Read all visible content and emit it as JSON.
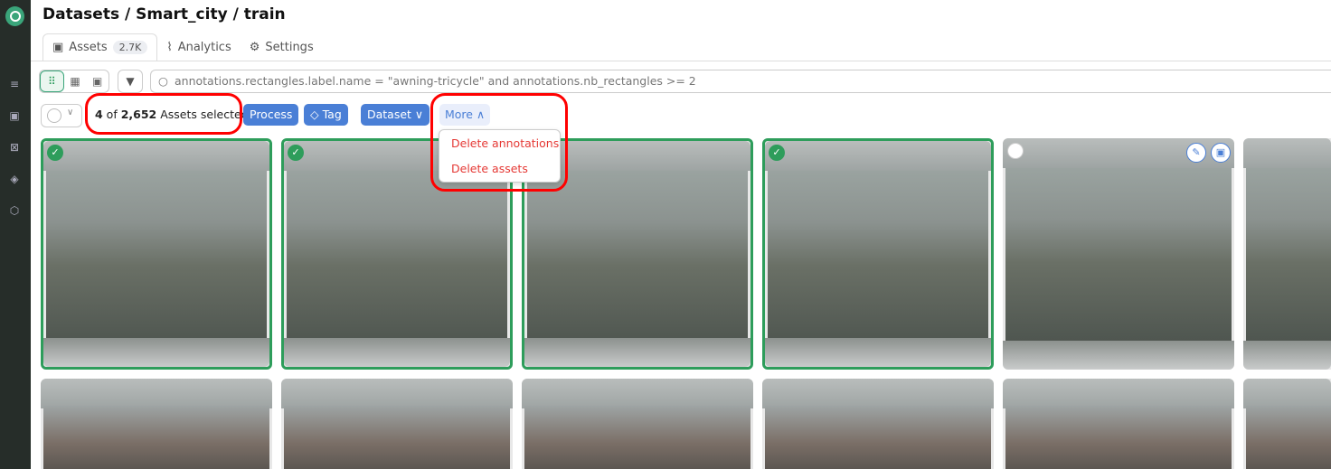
{
  "breadcrumb": "Datasets / Smart_city / train",
  "tabs": [
    {
      "label": "Assets",
      "badge": "2.7K"
    },
    {
      "label": "Analytics"
    },
    {
      "label": "Settings"
    }
  ],
  "search": {
    "query": "annotations.rectangles.label.name = \"awning-tricycle\" and annotations.nb_rectangles >= 2"
  },
  "selection": {
    "count": "4",
    "of": " of ",
    "total": "2,652",
    "suffix": " Assets selected"
  },
  "actions": {
    "process": "Process",
    "tag": "Tag",
    "dataset": "Dataset",
    "more": "More"
  },
  "more_menu": [
    "Delete annotations",
    "Delete assets"
  ],
  "colors": {
    "accent": "#4a7fd6",
    "selected": "#2e9d5b",
    "danger": "#e53935",
    "highlight": "#ff0000"
  },
  "assets_row1_selected": [
    true,
    true,
    true,
    true,
    false,
    false
  ]
}
